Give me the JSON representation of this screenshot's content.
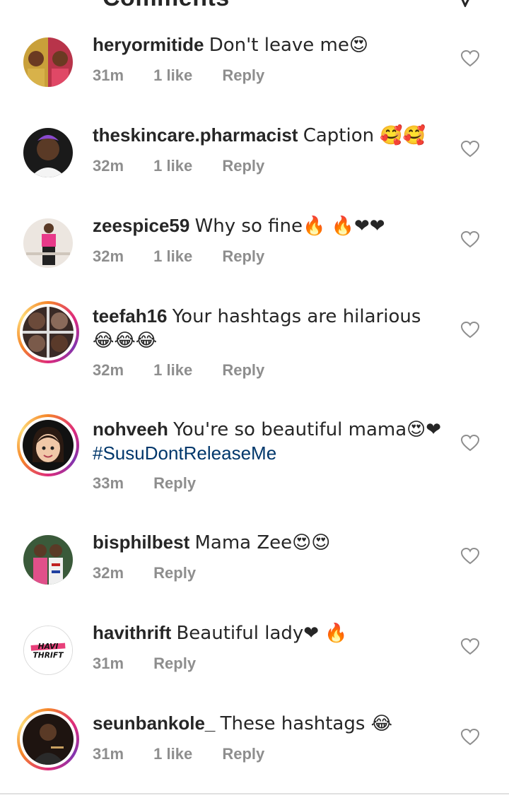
{
  "header": {
    "title": "Comments"
  },
  "comments": [
    {
      "username": "heryormitide",
      "text": "Don't leave me😍",
      "time": "31m",
      "likes": "1 like",
      "reply": "Reply"
    },
    {
      "username": "theskincare.pharmacist",
      "text": "Caption 🥰🥰",
      "time": "32m",
      "likes": "1 like",
      "reply": "Reply"
    },
    {
      "username": "zeespice59",
      "text": "Why so fine🔥 🔥❤❤",
      "time": "32m",
      "likes": "1 like",
      "reply": "Reply"
    },
    {
      "username": "teefah16",
      "text": "Your hashtags are hilarious 😂😂😂",
      "time": "32m",
      "likes": "1 like",
      "reply": "Reply"
    },
    {
      "username": "nohveeh",
      "text": "You're so beautiful mama😍❤",
      "hashtag": "#SusuDontReleaseMe",
      "time": "33m",
      "reply": "Reply"
    },
    {
      "username": "bisphilbest",
      "text": "Mama Zee😍😍",
      "time": "32m",
      "reply": "Reply"
    },
    {
      "username": "havithrift",
      "text": "Beautiful lady❤ 🔥",
      "time": "31m",
      "reply": "Reply",
      "avatar_text": [
        "HAVI",
        "THRIFT"
      ]
    },
    {
      "username": "seunbankole_",
      "text": "These hashtags 😂",
      "time": "31m",
      "likes": "1 like",
      "reply": "Reply"
    }
  ],
  "colors": {
    "username": "#262626",
    "meta": "#8e8e8e",
    "hashtag": "#00376b",
    "story_ring": "#dd2a7b"
  },
  "icons": {
    "header_left": "back-arrow-icon",
    "header_right": "send-icon",
    "comment_action": "heart-outline-icon"
  }
}
